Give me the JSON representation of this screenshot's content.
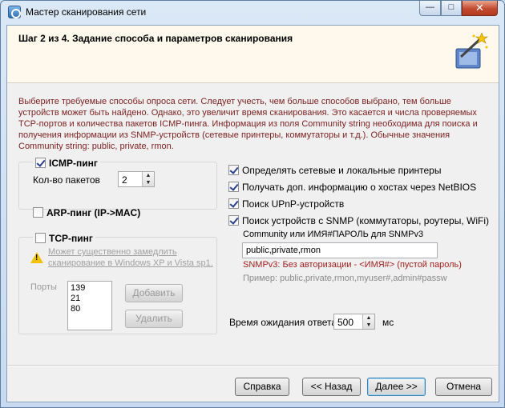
{
  "window": {
    "title": "Мастер сканирования сети",
    "min_glyph": "—",
    "max_glyph": "□",
    "close_glyph": "✕"
  },
  "header": {
    "step_title": "Шаг 2 из 4. Задание способа и параметров сканирования",
    "icon": "wizard-magic-wand-icon"
  },
  "description": "Выберите требуемые способы опроса сети. Следует учесть, чем больше способов выбрано, тем больше устройств может быть найдено. Однако, это увеличит время сканирования. Это касается и числа проверяемых TCP-портов и количества пакетов ICMP-пинга. Информация из поля Community string необходима для поиска и получения информации из SNMP-устройств (сетевые принтеры, коммутаторы и т.д.). Обычные значения Community string: public, private, rmon.",
  "icmp": {
    "label": "ICMP-пинг",
    "checked": true,
    "packets_label": "Кол-во пакетов",
    "packets_value": "2"
  },
  "arp": {
    "label": "ARP-пинг (IP->MAC)",
    "checked": false
  },
  "tcp": {
    "label": "TCP-пинг",
    "checked": false,
    "warning": "Может существенно замедлить сканирование в Windows XP и Vista sp1.",
    "ports_label": "Порты",
    "ports": [
      "139",
      "21",
      "80"
    ],
    "add_label": "Добавить",
    "remove_label": "Удалить"
  },
  "options": [
    {
      "label": "Определять сетевые и локальные принтеры",
      "checked": true
    },
    {
      "label": "Получать доп. информацию о хостах через NetBIOS",
      "checked": true
    },
    {
      "label": "Поиск UPnP-устройств",
      "checked": true
    },
    {
      "label": "Поиск устройств с SNMP (коммутаторы, роутеры, WiFi)",
      "checked": true
    }
  ],
  "snmp": {
    "community_label": "Community или ИМЯ#ПАРОЛЬ для SNMPv3",
    "community_value": "public,private,rmon",
    "note": "SNMPv3: Без авторизации - <ИМЯ#> (пустой пароль)",
    "example": "Пример: public,private,rmon,myuser#,admin#passw"
  },
  "timeout": {
    "label": "Время ожидания ответа",
    "value": "500",
    "unit": "мс"
  },
  "buttons": {
    "help": "Справка",
    "back": "<< Назад",
    "next": "Далее >>",
    "cancel": "Отмена"
  }
}
